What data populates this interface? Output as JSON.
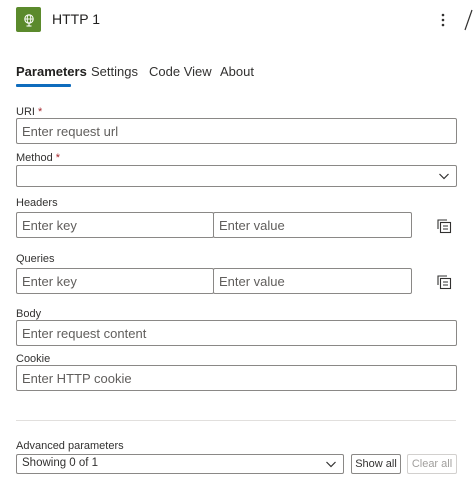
{
  "header": {
    "title": "HTTP 1",
    "icon": "globe-icon",
    "icon_color": "#5b8a2c",
    "more_icon": "more-vertical-icon"
  },
  "tabs": [
    {
      "label": "Parameters",
      "active": true
    },
    {
      "label": "Settings",
      "active": false
    },
    {
      "label": "Code View",
      "active": false
    },
    {
      "label": "About",
      "active": false
    }
  ],
  "fields": {
    "uri": {
      "label": "URI",
      "required_mark": "*",
      "placeholder": "Enter request url",
      "value": ""
    },
    "method": {
      "label": "Method",
      "required_mark": "*",
      "value": ""
    },
    "headers": {
      "label": "Headers",
      "key_placeholder": "Enter key",
      "value_placeholder": "Enter value"
    },
    "queries": {
      "label": "Queries",
      "key_placeholder": "Enter key",
      "value_placeholder": "Enter value"
    },
    "body": {
      "label": "Body",
      "placeholder": "Enter request content"
    },
    "cookie": {
      "label": "Cookie",
      "placeholder": "Enter HTTP cookie"
    }
  },
  "advanced": {
    "label": "Advanced parameters",
    "dropdown_value": "Showing 0 of 1",
    "show_all_label": "Show all",
    "clear_all_label": "Clear all"
  },
  "colors": {
    "accent": "#0f6cbd",
    "border": "#8a8886",
    "required": "#a4262c"
  }
}
